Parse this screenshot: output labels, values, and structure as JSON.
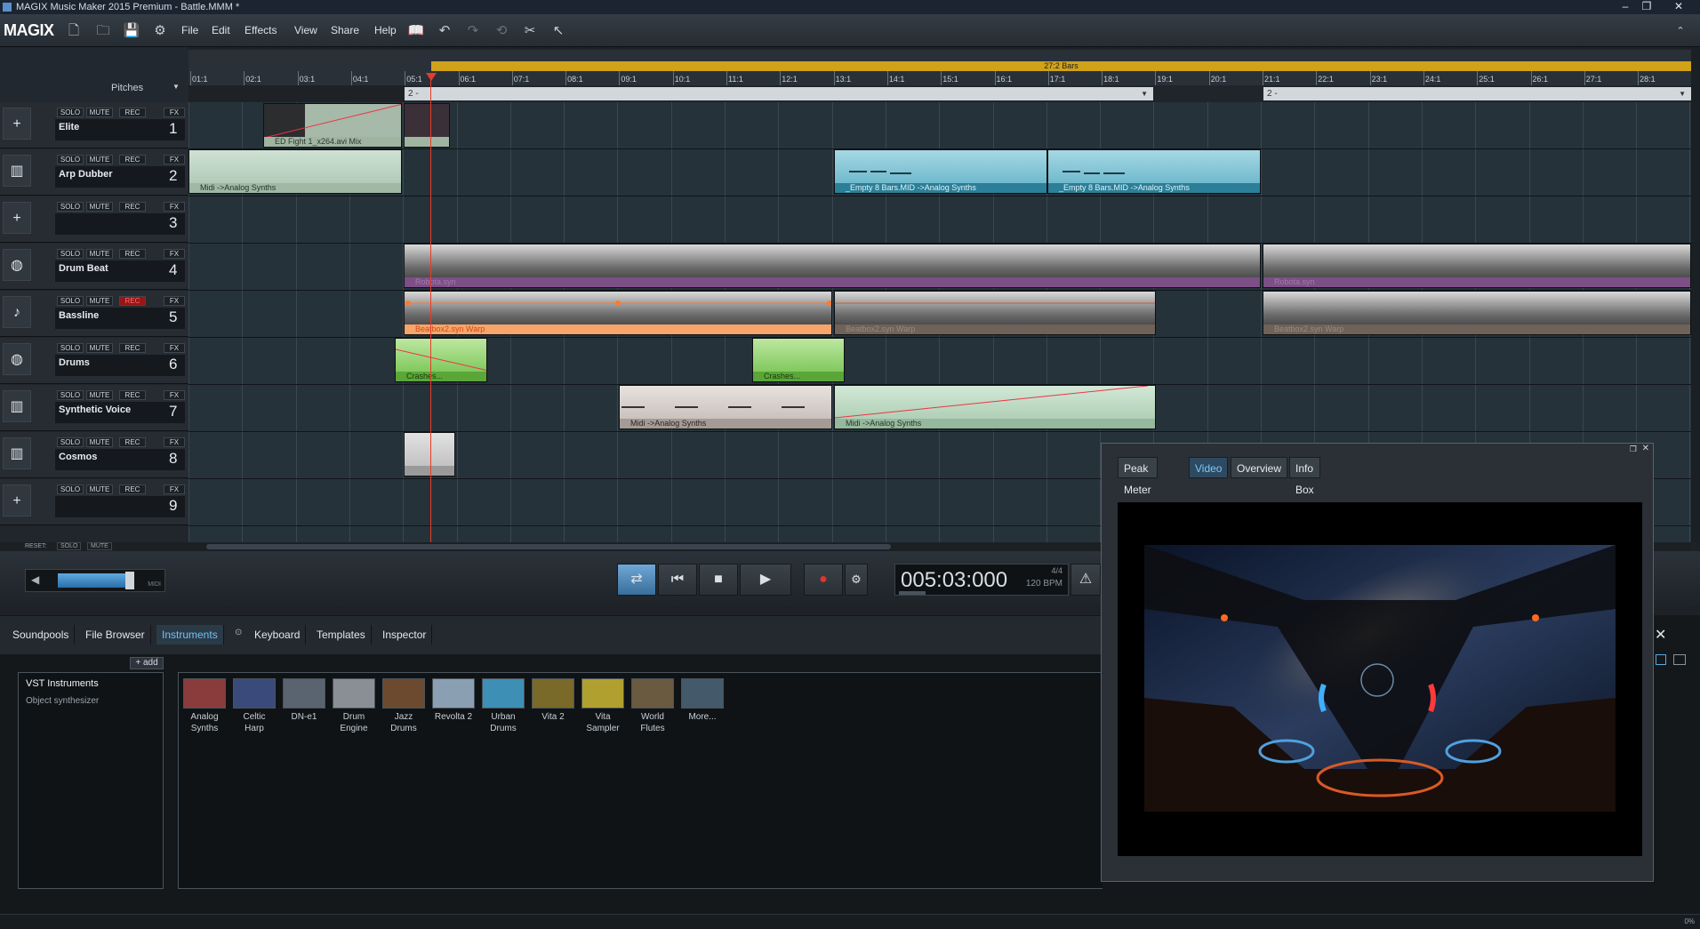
{
  "window": {
    "title": "MAGIX Music Maker 2015 Premium - Battle.MMM *"
  },
  "menubar": {
    "logo": "MAGIX",
    "menus": [
      "File",
      "Edit",
      "Effects",
      "View",
      "Share",
      "Help"
    ]
  },
  "ruler": {
    "tracklist_header": "Pitches",
    "loop_label": "27:2 Bars",
    "bars": [
      "01:1",
      "02:1",
      "03:1",
      "04:1",
      "05:1",
      "06:1",
      "07:1",
      "08:1",
      "09:1",
      "10:1",
      "11:1",
      "12:1",
      "13:1",
      "14:1",
      "15:1",
      "16:1",
      "17:1",
      "18:1",
      "19:1",
      "20:1",
      "21:1",
      "22:1",
      "23:1",
      "24:1",
      "25:1",
      "26:1",
      "27:1",
      "28:1"
    ],
    "scenes": [
      "2 -",
      "2 -"
    ]
  },
  "track_buttons": {
    "solo": "SOLO",
    "mute": "MUTE",
    "rec": "REC",
    "fx": "FX"
  },
  "tracks": [
    {
      "num": "1",
      "name": "Elite",
      "icon": "plus-icon"
    },
    {
      "num": "2",
      "name": "Arp Dubber",
      "icon": "synth-icon"
    },
    {
      "num": "3",
      "name": "",
      "icon": "plus-icon"
    },
    {
      "num": "4",
      "name": "Drum Beat",
      "icon": "drums-icon"
    },
    {
      "num": "5",
      "name": "Bassline",
      "icon": "guitar-icon"
    },
    {
      "num": "6",
      "name": "Drums",
      "icon": "drums-icon"
    },
    {
      "num": "7",
      "name": "Synthetic Voice",
      "icon": "synth-icon"
    },
    {
      "num": "8",
      "name": "Cosmos",
      "icon": "synth-icon"
    },
    {
      "num": "9",
      "name": "",
      "icon": "plus-icon"
    }
  ],
  "reset_bar": {
    "reset": "RESET:",
    "solo": "SOLO",
    "mute": "MUTE"
  },
  "objects": {
    "video": "ED Fight 1_x264.avi Mix",
    "midi_analog": "Midi ->Analog Synths",
    "empty8": "_Empty 8 Bars.MID ->Analog Synths",
    "robota": "Robota.syn",
    "beatbox_warp": "Beatbox2.syn   Warp",
    "crashes": "Crashes..."
  },
  "transport": {
    "time": "005:03:000",
    "signature": "4/4",
    "bpm": "120 BPM",
    "vol_label": "MIDI"
  },
  "mediapool": {
    "tabs": [
      "Soundpools",
      "File Browser",
      "Instruments",
      "Keyboard",
      "Templates",
      "Inspector"
    ],
    "active_tab": "Instruments",
    "add_label": "+ add",
    "list_title": "VST Instruments",
    "list_sub": "Object synthesizer",
    "instruments": [
      {
        "l1": "Analog",
        "l2": "Synths",
        "color": "#8a3b3b"
      },
      {
        "l1": "Celtic",
        "l2": "Harp",
        "color": "#3a4a7a"
      },
      {
        "l1": "DN-e1",
        "l2": "",
        "color": "#5a6470"
      },
      {
        "l1": "Drum",
        "l2": "Engine",
        "color": "#8a8f95"
      },
      {
        "l1": "Jazz",
        "l2": "Drums",
        "color": "#6b4a30"
      },
      {
        "l1": "Revolta 2",
        "l2": "",
        "color": "#8aa0b2"
      },
      {
        "l1": "Urban",
        "l2": "Drums",
        "color": "#3e8fb5"
      },
      {
        "l1": "Vita 2",
        "l2": "",
        "color": "#7a6a2a"
      },
      {
        "l1": "Vita",
        "l2": "Sampler",
        "color": "#b0a030"
      },
      {
        "l1": "World",
        "l2": "Flutes",
        "color": "#6a5a40"
      },
      {
        "l1": "More...",
        "l2": "",
        "color": "#445a6a"
      }
    ]
  },
  "video_window": {
    "tabs": [
      "Peak Meter",
      "Video",
      "Overview",
      "Info Box"
    ],
    "active_tab": "Video"
  },
  "status": {
    "right": "0%"
  }
}
